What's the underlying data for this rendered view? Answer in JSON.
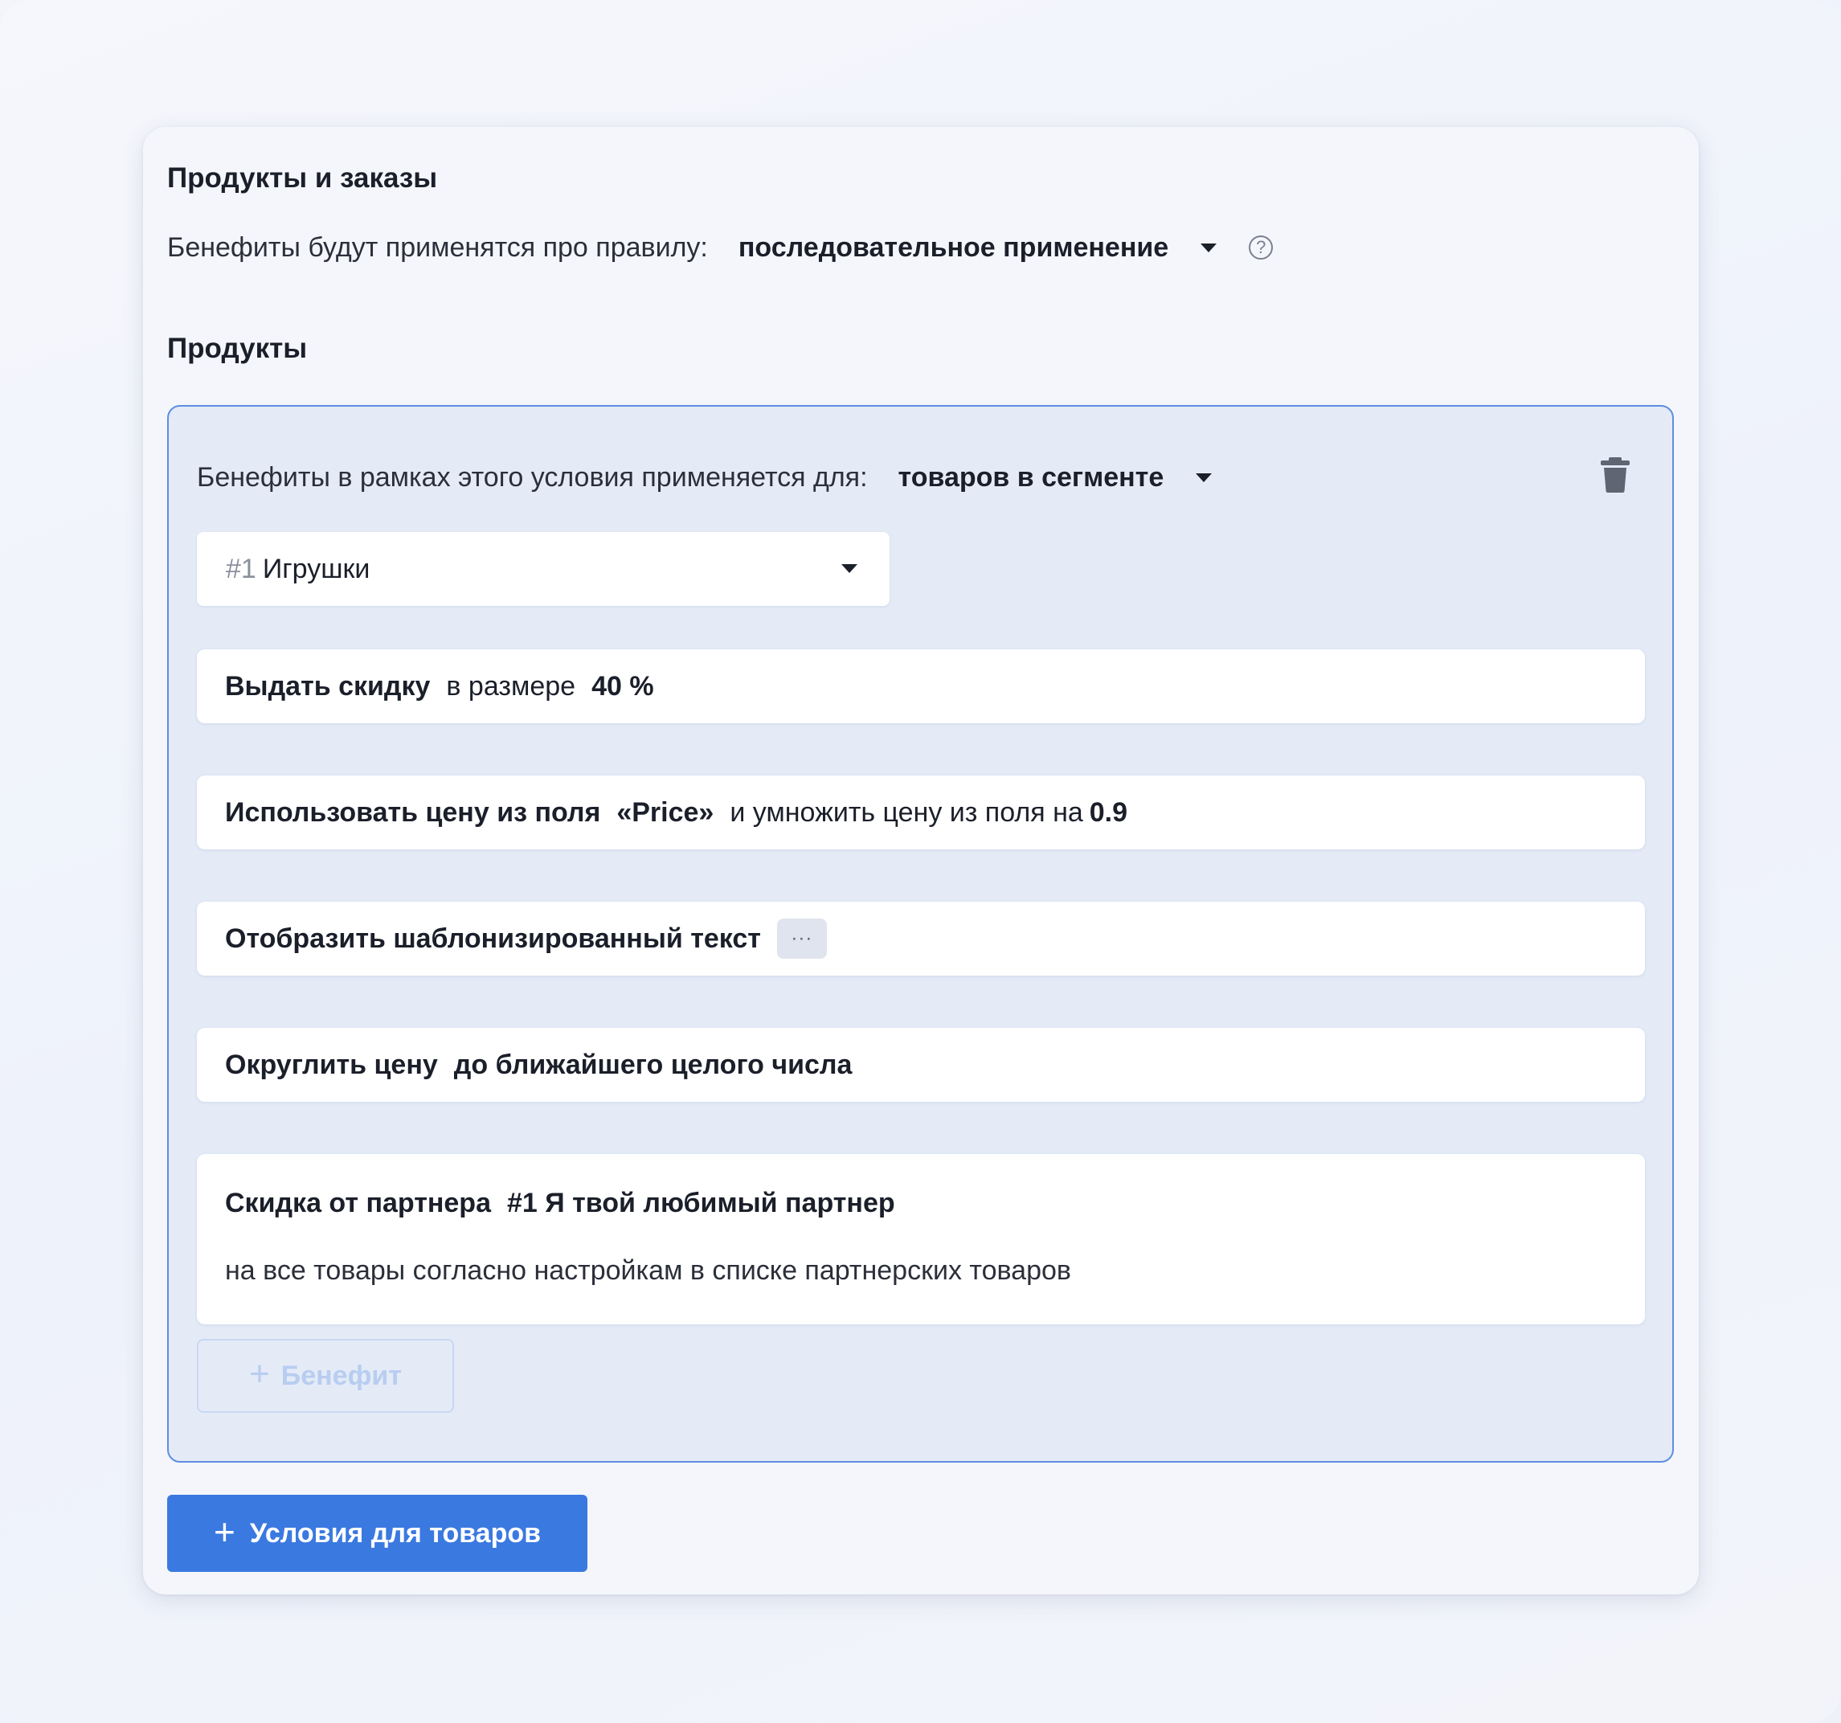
{
  "card": {
    "title": "Продукты и заказы",
    "rule_label": "Бенефиты будут применятся про правилу:",
    "rule_value": "последовательное применение",
    "help_glyph": "?"
  },
  "products": {
    "title": "Продукты",
    "condition": {
      "label": "Бенефиты в рамках этого условия применяется для:",
      "value": "товаров в сегменте",
      "segment": {
        "number": "#1",
        "name": "Игрушки"
      },
      "benefits": {
        "discount": {
          "action": "Выдать скидку",
          "text": "в размере",
          "amount": "40 %"
        },
        "price_field": {
          "action": "Использовать цену из поля",
          "field": "«Price»",
          "text": "и умножить цену из поля на",
          "multiplier": "0.9"
        },
        "template_text": {
          "action": "Отобразить шаблонизированный текст",
          "more_glyph": "···"
        },
        "rounding": {
          "action": "Округлить цену",
          "mode": "до ближайшего целого числа"
        },
        "partner": {
          "action": "Скидка от партнера",
          "partner_name": "#1 Я твой любимый партнер",
          "description": "на все товары согласно настройкам в списке партнерских товаров"
        }
      },
      "add_benefit": {
        "plus": "+",
        "label": "Бенефит"
      }
    },
    "add_conditions": {
      "plus": "+",
      "label": "Условия для товаров"
    }
  },
  "colors": {
    "primary": "#3a79e0",
    "condition_border": "#5d8ee0",
    "condition_bg": "#e4ebf7",
    "card_bg": "#f4f6fb"
  },
  "icons": {
    "rule_dropdown": "caret-down-icon",
    "help": "help-circle-icon",
    "delete": "trash-icon",
    "more": "ellipsis-icon",
    "add": "plus-icon"
  }
}
